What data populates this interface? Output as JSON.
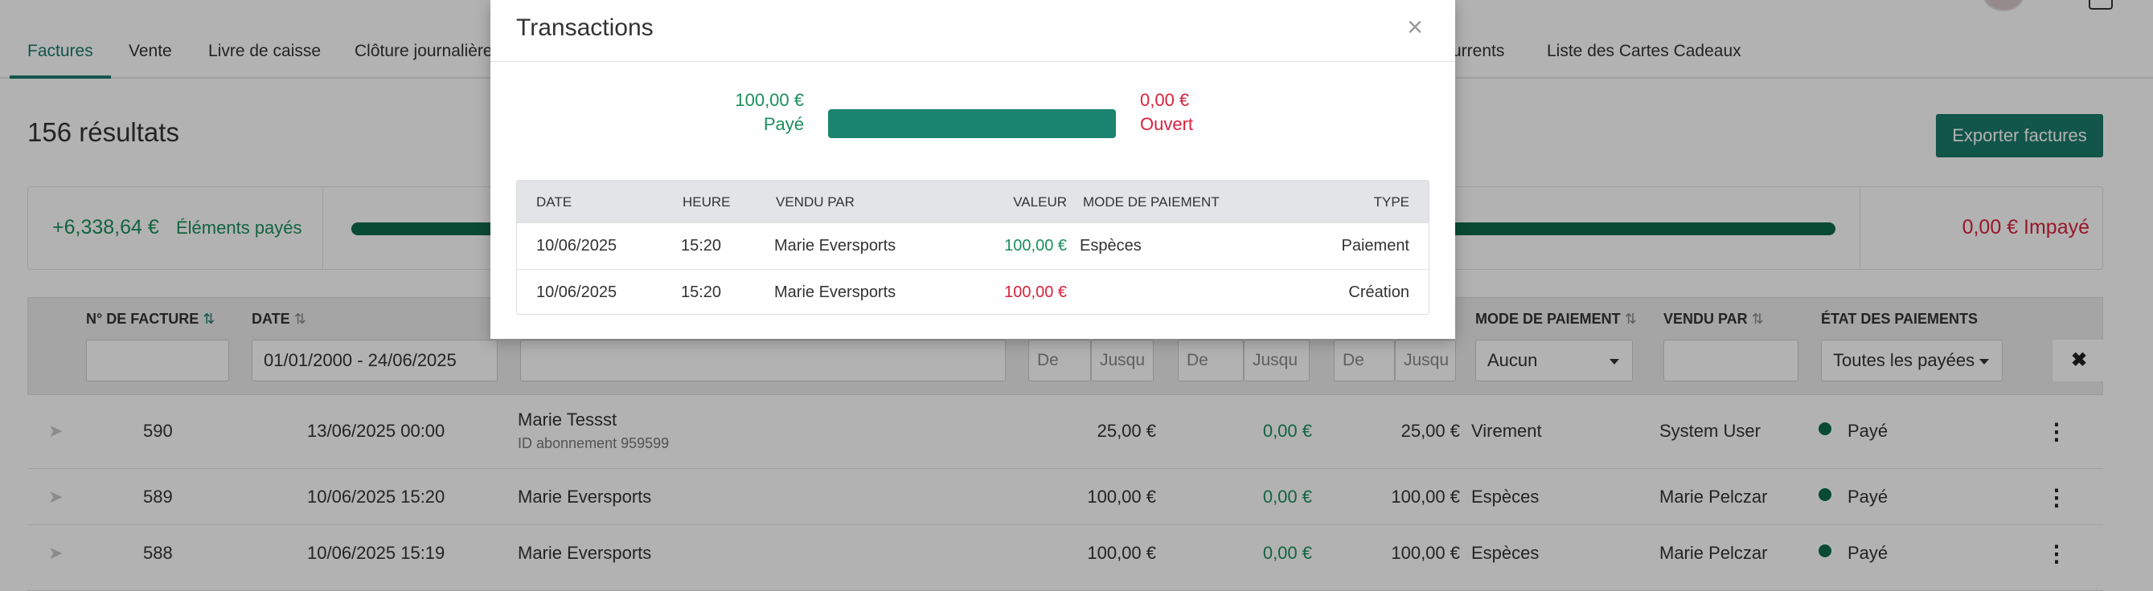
{
  "nav": {
    "tabs": [
      {
        "label": "Factures",
        "active": true
      },
      {
        "label": "Vente"
      },
      {
        "label": "Livre de caisse"
      },
      {
        "label": "Clôture journalière"
      },
      {
        "label": "urrents"
      },
      {
        "label": "Liste des Cartes Cadeaux"
      }
    ]
  },
  "page": {
    "result_count": "156 résultats",
    "export_label": "Exporter factures"
  },
  "summary": {
    "paid_amount": "+6,338,64 €",
    "paid_label": "Éléments payés",
    "paid_fraction": 1.0,
    "unpaid": "0,00 € Impayé"
  },
  "filters": {
    "headers": {
      "invoice_no": "N° DE FACTURE",
      "date": "DATE",
      "payment_mode": "MODE DE PAIEMENT",
      "sold_by": "VENDU PAR",
      "payment_state": "ÉTAT DES PAIEMENTS"
    },
    "date_range": "01/01/2000 - 24/06/2025",
    "from_placeholder": "De",
    "to_placeholder": "Jusqu",
    "payment_mode_value": "Aucun",
    "payment_state_value": "Toutes les payées",
    "clear_icon": "✖"
  },
  "rows": [
    {
      "number": "590",
      "date": "13/06/2025 00:00",
      "customer": "Marie Tessst",
      "sub": "ID abonnement 959599",
      "total": "25,00 €",
      "open": "0,00 €",
      "paid": "25,00 €",
      "mode": "Virement",
      "sold_by": "System User",
      "state": "Payé"
    },
    {
      "number": "589",
      "date": "10/06/2025 15:20",
      "customer": "Marie Eversports",
      "sub": "",
      "total": "100,00 €",
      "open": "0,00 €",
      "paid": "100,00 €",
      "mode": "Espèces",
      "sold_by": "Marie Pelczar",
      "state": "Payé"
    },
    {
      "number": "588",
      "date": "10/06/2025 15:19",
      "customer": "Marie Eversports",
      "sub": "",
      "total": "100,00 €",
      "open": "0,00 €",
      "paid": "100,00 €",
      "mode": "Espèces",
      "sold_by": "Marie Pelczar",
      "state": "Payé"
    }
  ],
  "modal": {
    "title": "Transactions",
    "close_icon": "×",
    "paid_amount": "100,00 €",
    "paid_label": "Payé",
    "paid_fraction": 1.0,
    "open_amount": "0,00 €",
    "open_label": "Ouvert",
    "columns": {
      "date": "DATE",
      "time": "HEURE",
      "sold_by": "VENDU PAR",
      "value": "VALEUR",
      "payment_mode": "MODE DE PAIEMENT",
      "type": "TYPE"
    },
    "transactions": [
      {
        "date": "10/06/2025",
        "time": "15:20",
        "sold_by": "Marie Eversports",
        "value": "100,00 €",
        "value_status": "positive",
        "mode": "Espèces",
        "type": "Paiement"
      },
      {
        "date": "10/06/2025",
        "time": "15:20",
        "sold_by": "Marie Eversports",
        "value": "100,00 €",
        "value_status": "negative",
        "mode": "",
        "type": "Création"
      }
    ]
  },
  "colors": {
    "accent": "#1a7a6a",
    "paid_green": "#1a8f5c",
    "unpaid_red": "#d8213e"
  }
}
